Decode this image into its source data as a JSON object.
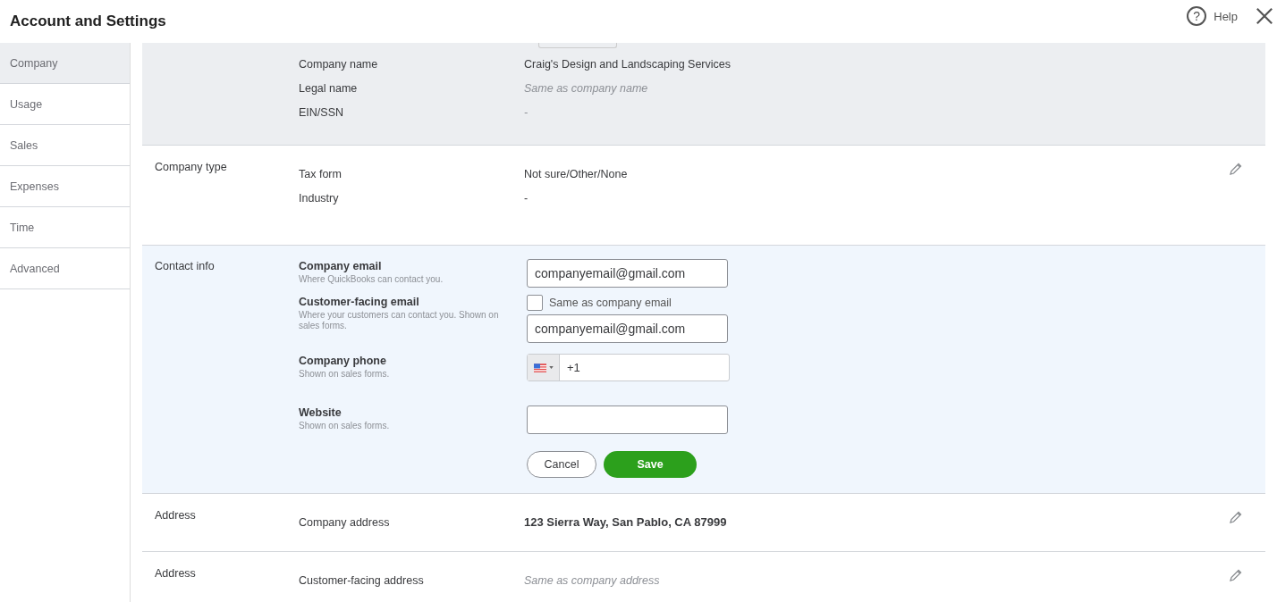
{
  "header": {
    "title": "Account and Settings",
    "help_icon": "?",
    "help": "Help"
  },
  "sidebar": {
    "items": [
      {
        "label": "Company",
        "selected": true
      },
      {
        "label": "Usage",
        "selected": false
      },
      {
        "label": "Sales",
        "selected": false
      },
      {
        "label": "Expenses",
        "selected": false
      },
      {
        "label": "Time",
        "selected": false
      },
      {
        "label": "Advanced",
        "selected": false
      }
    ]
  },
  "sections": [
    {
      "kind": "summary",
      "rows": [
        {
          "label": "Company name",
          "kind": "text",
          "value": "Craig's Design and Landscaping Services"
        },
        {
          "label": "Legal name",
          "kind": "placeholder",
          "placeholder": "Same as company name"
        },
        {
          "label": "EIN/SSN",
          "kind": "placeholder",
          "placeholder": "-"
        }
      ]
    },
    {
      "kind": "display",
      "title": "Company type",
      "rows": [
        {
          "label": "Tax form",
          "kind": "text",
          "value": "Not sure/Other/None"
        },
        {
          "label": "Industry",
          "kind": "text",
          "value": "-"
        }
      ]
    },
    {
      "kind": "form",
      "title": "Contact info",
      "fields": [
        {
          "kind": "input",
          "label": "Company email",
          "hint": "Where QuickBooks can contact you.",
          "value": "companyemail@gmail.com"
        },
        {
          "kind": "input",
          "label": "Customer-facing email",
          "hint": "Where your customers can contact you. Shown on sales forms.",
          "checkbox": {
            "label": "Same as company email",
            "checked": false
          },
          "value": "companyemail@gmail.com"
        },
        {
          "kind": "phone",
          "label": "Company phone",
          "hint": "Shown on sales forms.",
          "value": "+1"
        },
        {
          "kind": "input",
          "label": "Website",
          "hint": "Shown on sales forms."
        }
      ],
      "cancel": "Cancel",
      "save": "Save"
    },
    {
      "kind": "display",
      "title": "Address",
      "rows": [
        {
          "label": "Company address",
          "kind": "bold",
          "value": "123 Sierra Way, San Pablo, CA 87999"
        }
      ]
    },
    {
      "kind": "display",
      "title": "Address",
      "rows": [
        {
          "label": "Customer-facing address",
          "kind": "placeholder",
          "placeholder": "Same as company address"
        }
      ]
    }
  ]
}
